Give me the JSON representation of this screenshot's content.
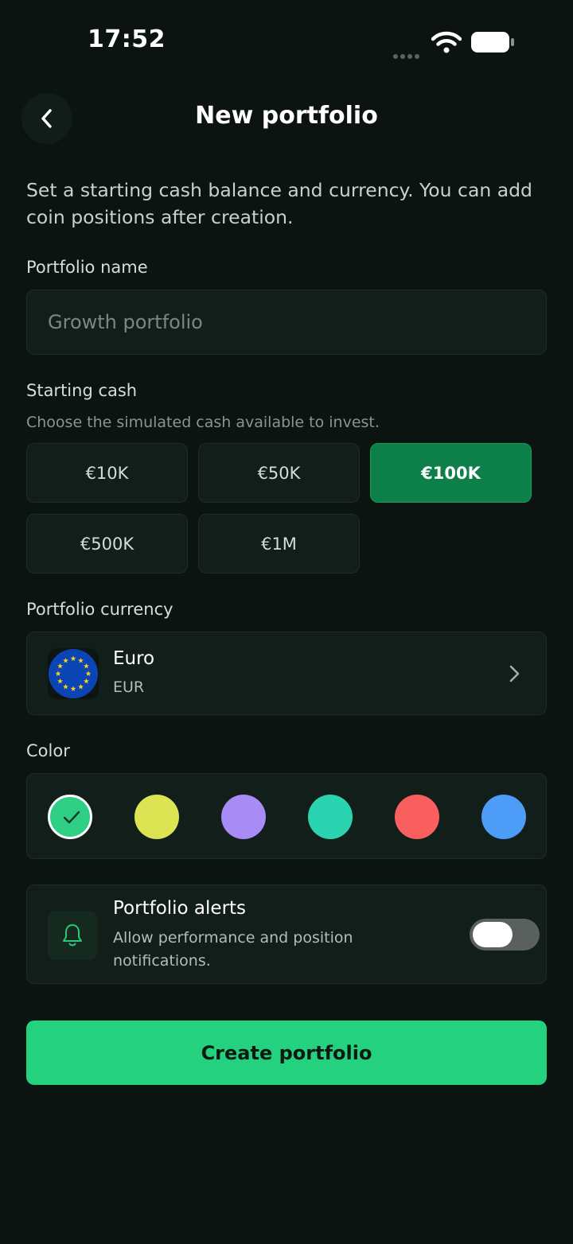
{
  "status_bar": {
    "time": "17:52",
    "wifi_icon": "wifi-icon",
    "battery_icon": "battery-icon"
  },
  "header": {
    "title": "New portfolio",
    "back_icon": "chevron-left-icon"
  },
  "intro": "Set a starting cash balance and currency. You can add coin positions after creation.",
  "portfolio_name": {
    "label": "Portfolio name",
    "placeholder": "Growth portfolio",
    "value": ""
  },
  "starting_cash": {
    "label": "Starting cash",
    "help": "Choose the simulated cash available to invest.",
    "options": [
      "€10K",
      "€50K",
      "€100K",
      "€500K",
      "€1M"
    ],
    "selected": "€100K"
  },
  "currency": {
    "label": "Portfolio currency",
    "name": "Euro",
    "code": "EUR",
    "flag_icon": "eu-flag-icon"
  },
  "color": {
    "label": "Color",
    "options": [
      "#2ecf85",
      "#dde454",
      "#a98bf5",
      "#2ad4b0",
      "#fa5f5f",
      "#4d9cf8"
    ],
    "selected_index": 0
  },
  "alerts": {
    "title": "Portfolio alerts",
    "description": "Allow performance and position notifications.",
    "enabled": false,
    "icon": "bell-icon"
  },
  "submit_label": "Create portfolio",
  "colors": {
    "background": "#0b1411",
    "accent": "#24d17f",
    "selected_option": "#0c8048",
    "card": "#111e1a"
  }
}
